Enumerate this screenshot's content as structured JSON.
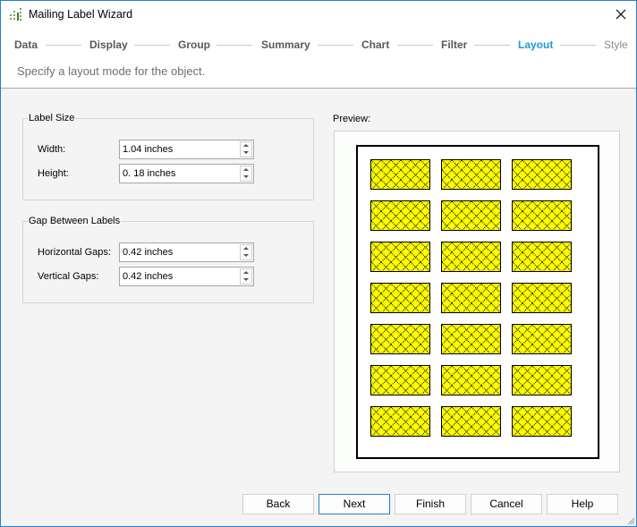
{
  "window": {
    "title": "Mailing Label Wizard",
    "icon": "wizard-chart-icon",
    "close_icon": "close-icon"
  },
  "steps": [
    {
      "label": "Data",
      "state": "done"
    },
    {
      "label": "Display",
      "state": "done"
    },
    {
      "label": "Group",
      "state": "done"
    },
    {
      "label": "Summary",
      "state": "done"
    },
    {
      "label": "Chart",
      "state": "done"
    },
    {
      "label": "Filter",
      "state": "done"
    },
    {
      "label": "Layout",
      "state": "active"
    },
    {
      "label": "Style",
      "state": "future"
    }
  ],
  "subtitle": "Specify a layout mode for the object.",
  "label_size": {
    "legend": "Label Size",
    "width_label": "Width:",
    "width_value": "1.04 inches",
    "height_label": "Height:",
    "height_value": "0. 18 inches"
  },
  "gap": {
    "legend": "Gap Between Labels",
    "horizontal_label": "Horizontal Gaps:",
    "horizontal_value": "0.42 inches",
    "vertical_label": "Vertical Gaps:",
    "vertical_value": "0.42 inches"
  },
  "preview": {
    "label": "Preview:",
    "rows": 7,
    "columns": 3,
    "label_color": "#ffff00",
    "pattern_color": "#000000"
  },
  "buttons": {
    "back": "Back",
    "next": "Next",
    "finish": "Finish",
    "cancel": "Cancel",
    "help": "Help"
  },
  "colors": {
    "accent": "#1e9ad6",
    "window_border": "#2b7fd0"
  }
}
